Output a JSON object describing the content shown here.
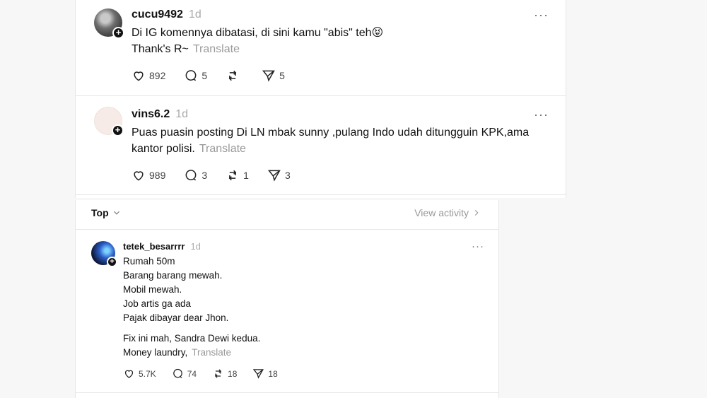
{
  "feed_top": {
    "posts": [
      {
        "username": "cucu9492",
        "time": "1d",
        "text_lines": [
          "Di IG komennya dibatasi, di sini kamu \"abis\" teh😝",
          "Thank's R~"
        ],
        "translate_label": "Translate",
        "likes": "892",
        "replies": "5",
        "reposts": "",
        "shares": "5"
      },
      {
        "username": "vins6.2",
        "time": "1d",
        "text_lines": [
          "Puas puasin posting Di LN mbak sunny ,pulang Indo udah ditungguin KPK,ama",
          "kantor polisi."
        ],
        "translate_label": "Translate",
        "likes": "989",
        "replies": "3",
        "reposts": "1",
        "shares": "3"
      }
    ]
  },
  "feed_bottom": {
    "sort_label": "Top",
    "view_activity_label": "View activity",
    "post": {
      "username": "tetek_besarrrr",
      "time": "1d",
      "text_lines": [
        "Rumah 50m",
        "Barang barang mewah.",
        "Mobil mewah.",
        "Job artis ga ada",
        "Pajak dibayar dear Jhon.",
        "Fix ini mah, Sandra Dewi kedua.",
        "Money laundry,"
      ],
      "translate_label": "Translate",
      "likes": "5.7K",
      "replies": "74",
      "reposts": "18",
      "shares": "18"
    }
  },
  "icons": {
    "like": "heart-icon",
    "reply": "comment-icon",
    "repost": "repost-icon",
    "share": "send-icon",
    "more": "more-icon",
    "follow": "plus-icon",
    "sort": "chevron-down-icon",
    "view_activity": "chevron-right-icon"
  }
}
